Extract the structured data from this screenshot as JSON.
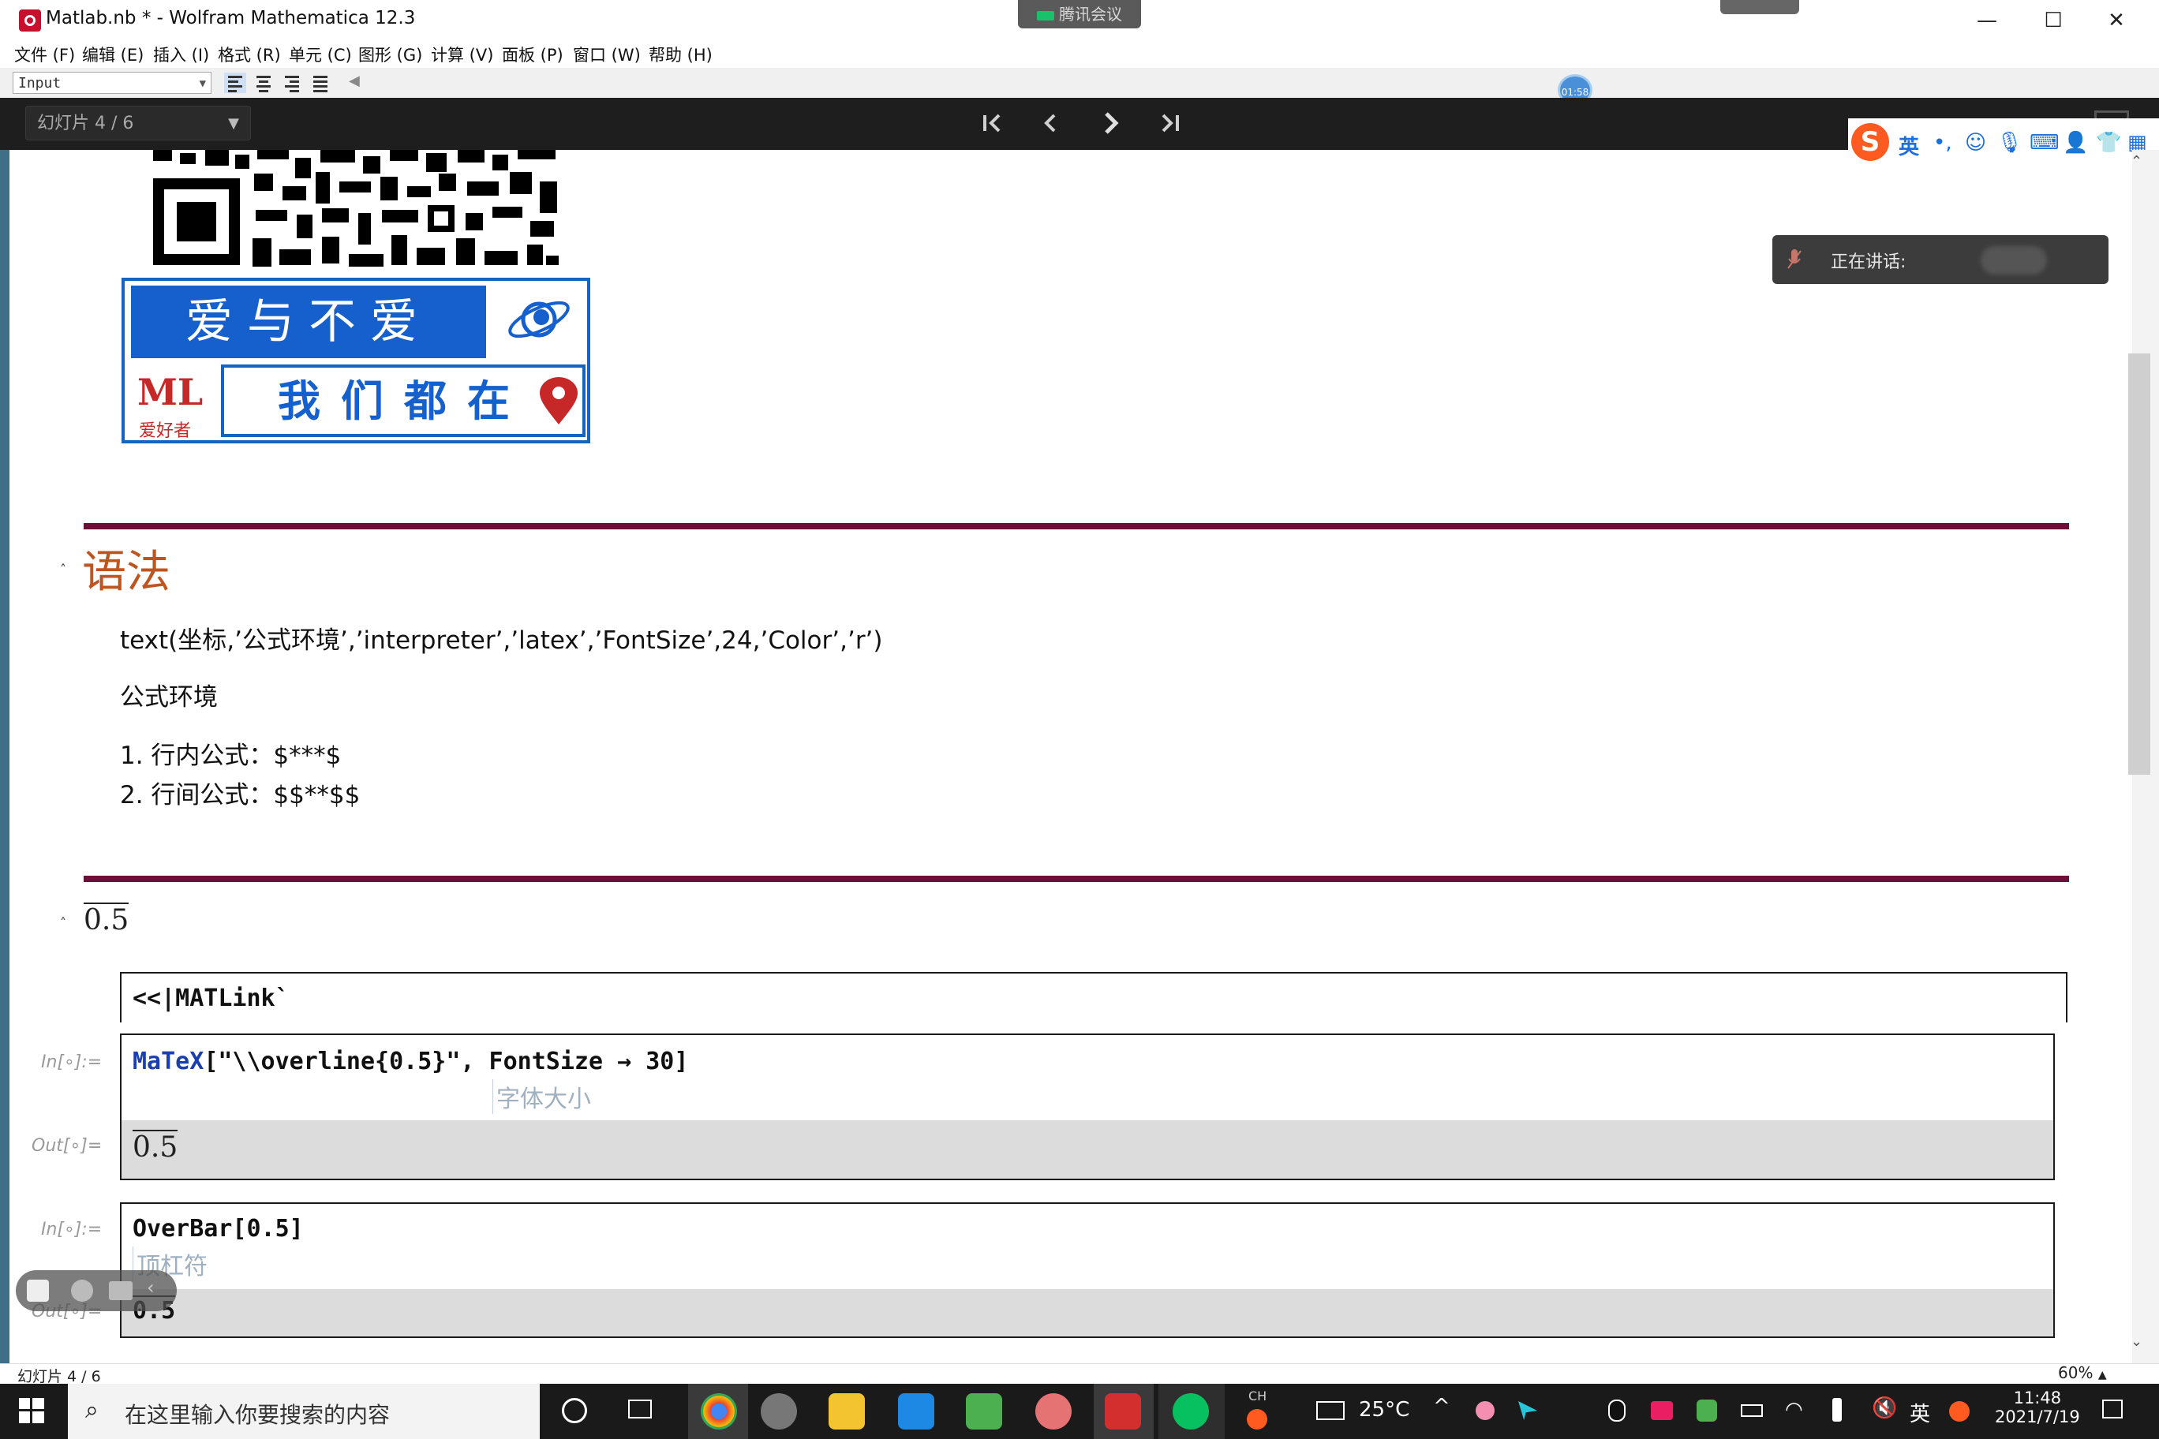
{
  "window": {
    "title": "Matlab.nb * - Wolfram Mathematica 12.3",
    "meeting_tab": "腾讯会议",
    "controls": {
      "minimize": "—",
      "maximize": "☐",
      "close": "✕"
    }
  },
  "menu": [
    "文件 (F)",
    "编辑 (E)",
    "插入 (I)",
    "格式 (R)",
    "单元 (C)",
    "图形 (G)",
    "计算 (V)",
    "面板 (P)",
    "窗口 (W)",
    "帮助 (H)"
  ],
  "toolbar": {
    "style_value": "Input",
    "timer": "01:58"
  },
  "slideshow": {
    "selector": "幻灯片 4 / 6",
    "nav": {
      "first": "|<",
      "prev": "<",
      "next": ">",
      "last": ">|"
    }
  },
  "ime": {
    "logo": "S",
    "lang": "英",
    "punct": "•,"
  },
  "speaking": {
    "label": "正在讲话:"
  },
  "banner": {
    "top_text": "爱与不爱",
    "logo_text": "ML",
    "logo_sub": "爱好者",
    "bottom_text": "我们都在"
  },
  "section": {
    "title": "语法",
    "syntax_line": "text(坐标,’公式环境’,’interpreter’,’latex’,’FontSize’,24,’Color’,’r’)",
    "env_label": "公式环境",
    "items": [
      "1. 行内公式：$***$",
      "2. 行间公式：$$**$$"
    ]
  },
  "subsection": {
    "title": "0.5"
  },
  "cells": {
    "load": "<<|MATLink`",
    "cell1": {
      "in_label": "In[∘]:=",
      "func": "MaTeX",
      "args": "[\"\\\\overline{0.5}\", FontSize → 30]",
      "hint": "字体大小",
      "out_label": "Out[∘]=",
      "out_value": "0.5"
    },
    "cell2": {
      "in_label": "In[∘]:=",
      "code": "OverBar[0.5]",
      "hint": "顶杠符",
      "out_label": "Out[∘]=",
      "out_value": "0.5"
    }
  },
  "status": {
    "left": "幻灯片 4 / 6",
    "zoom": "60%"
  },
  "taskbar": {
    "search_placeholder": "在这里输入你要搜索的内容",
    "ch_label": "CH",
    "temperature": "25°C",
    "lang": "英",
    "time": "11:48",
    "date": "2021/7/19"
  }
}
